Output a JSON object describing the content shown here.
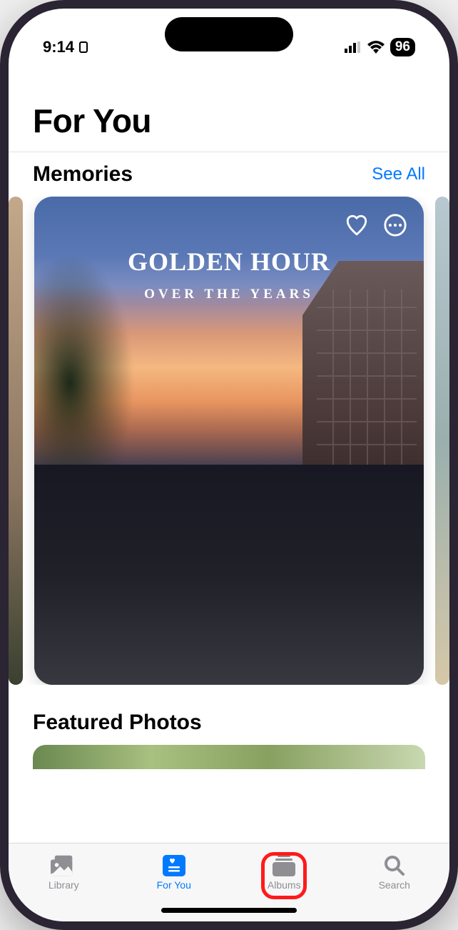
{
  "status_bar": {
    "time": "9:14",
    "battery_percent": "96"
  },
  "page": {
    "title": "For You"
  },
  "sections": {
    "memories": {
      "title": "Memories",
      "see_all": "See All",
      "card": {
        "title": "GOLDEN HOUR",
        "subtitle": "OVER THE YEARS"
      }
    },
    "featured": {
      "title": "Featured Photos"
    }
  },
  "tabs": {
    "library": "Library",
    "for_you": "For You",
    "albums": "Albums",
    "search": "Search"
  },
  "colors": {
    "accent": "#007aff",
    "highlight": "#ff1a1a"
  }
}
